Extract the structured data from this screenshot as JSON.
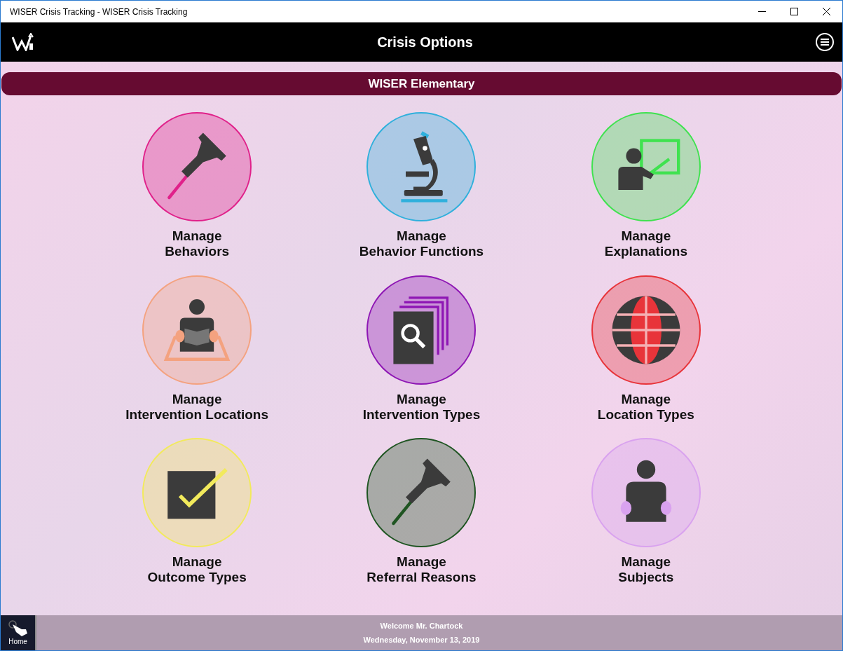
{
  "window": {
    "title": "WISER Crisis Tracking - WISER Crisis Tracking"
  },
  "header": {
    "title": "Crisis Options"
  },
  "school_bar": {
    "label": "WISER Elementary"
  },
  "tiles": [
    {
      "kind": "pin",
      "color": "#e0218a",
      "line1": "Manage",
      "line2": "Behaviors"
    },
    {
      "kind": "microscope",
      "color": "#2fb0dc",
      "line1": "Manage",
      "line2": "Behavior Functions"
    },
    {
      "kind": "teacher",
      "color": "#3fe24f",
      "line1": "Manage",
      "line2": "Explanations"
    },
    {
      "kind": "reading-area",
      "color": "#f4a27f",
      "line1": "Manage",
      "line2": "Intervention Locations"
    },
    {
      "kind": "document-search",
      "color": "#8e16b4",
      "line1": "Manage",
      "line2": "Intervention Types"
    },
    {
      "kind": "globe",
      "color": "#e8343a",
      "line1": "Manage",
      "line2": "Location Types"
    },
    {
      "kind": "checkbox",
      "color": "#f2ea5c",
      "line1": "Manage",
      "line2": "Outcome Types"
    },
    {
      "kind": "pin",
      "color": "#1f5522",
      "line1": "Manage",
      "line2": "Referral Reasons"
    },
    {
      "kind": "reader",
      "color": "#d9a2ef",
      "line1": "Manage",
      "line2": "Subjects"
    }
  ],
  "footer": {
    "home_label": "Home",
    "welcome": "Welcome Mr. Chartock",
    "date": "Wednesday, November 13, 2019"
  }
}
